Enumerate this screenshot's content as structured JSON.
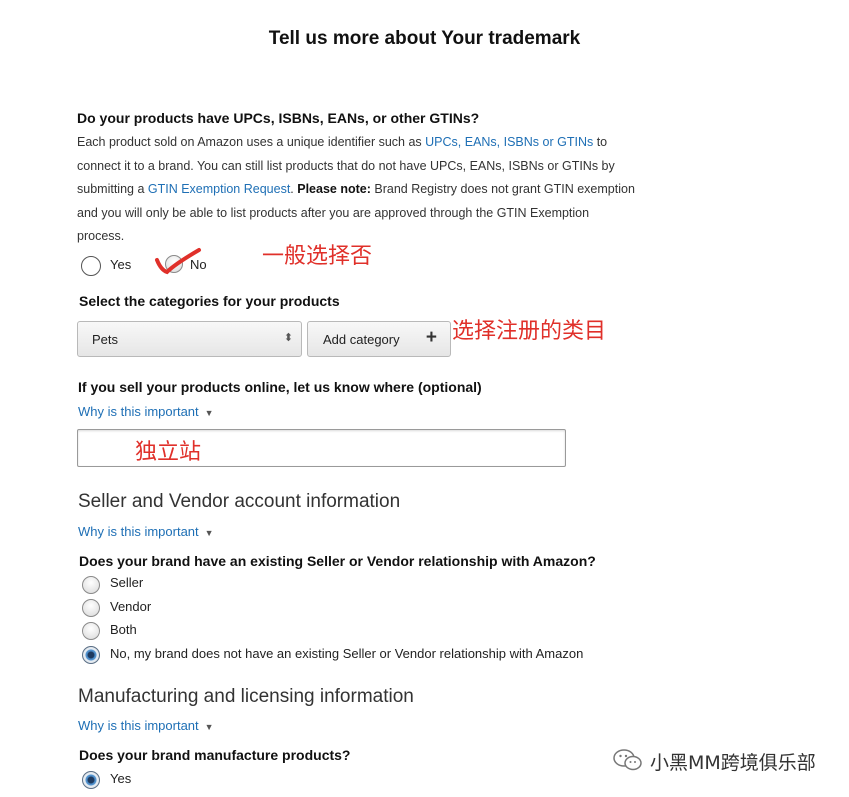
{
  "page": {
    "title": "Tell us more about Your trademark"
  },
  "gtin": {
    "question": "Do your products have UPCs, ISBNs, EANs, or other GTINs?",
    "line1_a": "Each product sold on Amazon uses a unique identifier such as ",
    "line1_link": "UPCs, EANs, ISBNs or GTINs",
    "line1_b": " to",
    "line2": "connect it to a brand. You can still list products that do not have UPCs, EANs, ISBNs or GTINs by",
    "line3_a": "submitting a ",
    "line3_link": "GTIN Exemption Request",
    "line3_b": ". ",
    "line3_bold": "Please note:",
    "line3_c": " Brand Registry does not grant GTIN exemption",
    "line4": "and you will only be able to list products after you are approved through the GTIN Exemption",
    "line5": "process.",
    "option_yes": "Yes",
    "option_no": "No",
    "annotation": "一般选择否"
  },
  "categories": {
    "label": "Select the categories for your products",
    "selected": "Pets",
    "add_button": "Add category",
    "annotation": "选择注册的类目"
  },
  "online": {
    "question": "If you sell your products online, let us know where (optional)",
    "why_link": "Why is this important",
    "input_value": "独立站"
  },
  "seller": {
    "heading": "Seller and Vendor account information",
    "why_link": "Why is this important",
    "question": "Does your brand have an existing Seller or Vendor relationship with Amazon?",
    "options": [
      "Seller",
      "Vendor",
      "Both",
      "No, my brand does not have an existing Seller or Vendor relationship with Amazon"
    ],
    "selected_index": 3
  },
  "manufacturing": {
    "heading": "Manufacturing and licensing information",
    "why_link": "Why is this important",
    "question": "Does your brand manufacture products?",
    "options": [
      "Yes"
    ],
    "selected_index": 0
  },
  "watermark": {
    "text": "小黑MM跨境俱乐部"
  },
  "colors": {
    "link": "#1e6fb5",
    "annotation_red": "#e0302a"
  }
}
